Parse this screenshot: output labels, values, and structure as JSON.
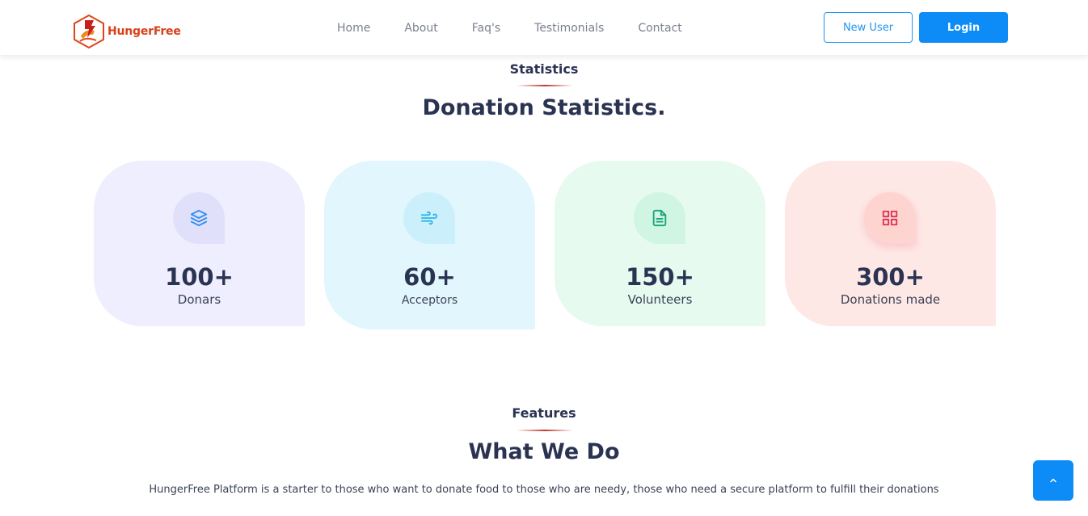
{
  "brand": {
    "name": "HungerFree",
    "color": "#d9401a"
  },
  "nav": [
    "Home",
    "About",
    "Faq's",
    "Testimonials",
    "Contact"
  ],
  "auth": {
    "new_user": "New User",
    "login": "Login"
  },
  "stats_section": {
    "kicker": "Statistics",
    "title": "Donation Statistics."
  },
  "stats": [
    {
      "value": "100+",
      "label": "Donars",
      "icon": "layers-icon",
      "bg": "#efeefe",
      "bubble": "#e1e0fb",
      "accent": "#2d8cf0"
    },
    {
      "value": "60+",
      "label": "Acceptors",
      "icon": "wind-icon",
      "bg": "#e2f6fd",
      "bubble": "#ccf0fb",
      "accent": "#2cb6e8"
    },
    {
      "value": "150+",
      "label": "Volunteers",
      "icon": "file-text-icon",
      "bg": "#e6faf0",
      "bubble": "#d0f5e3",
      "accent": "#1aa57a"
    },
    {
      "value": "300+",
      "label": "Donations made",
      "icon": "grid-icon",
      "bg": "#fee8e6",
      "bubble": "#fdd4d0",
      "accent": "#e0314e"
    }
  ],
  "features_section": {
    "kicker": "Features",
    "title": "What We Do"
  },
  "features_description": "HungerFree Platform is a starter to those who want to donate food to those who are needy, those who need a secure platform to fulfill their donations"
}
